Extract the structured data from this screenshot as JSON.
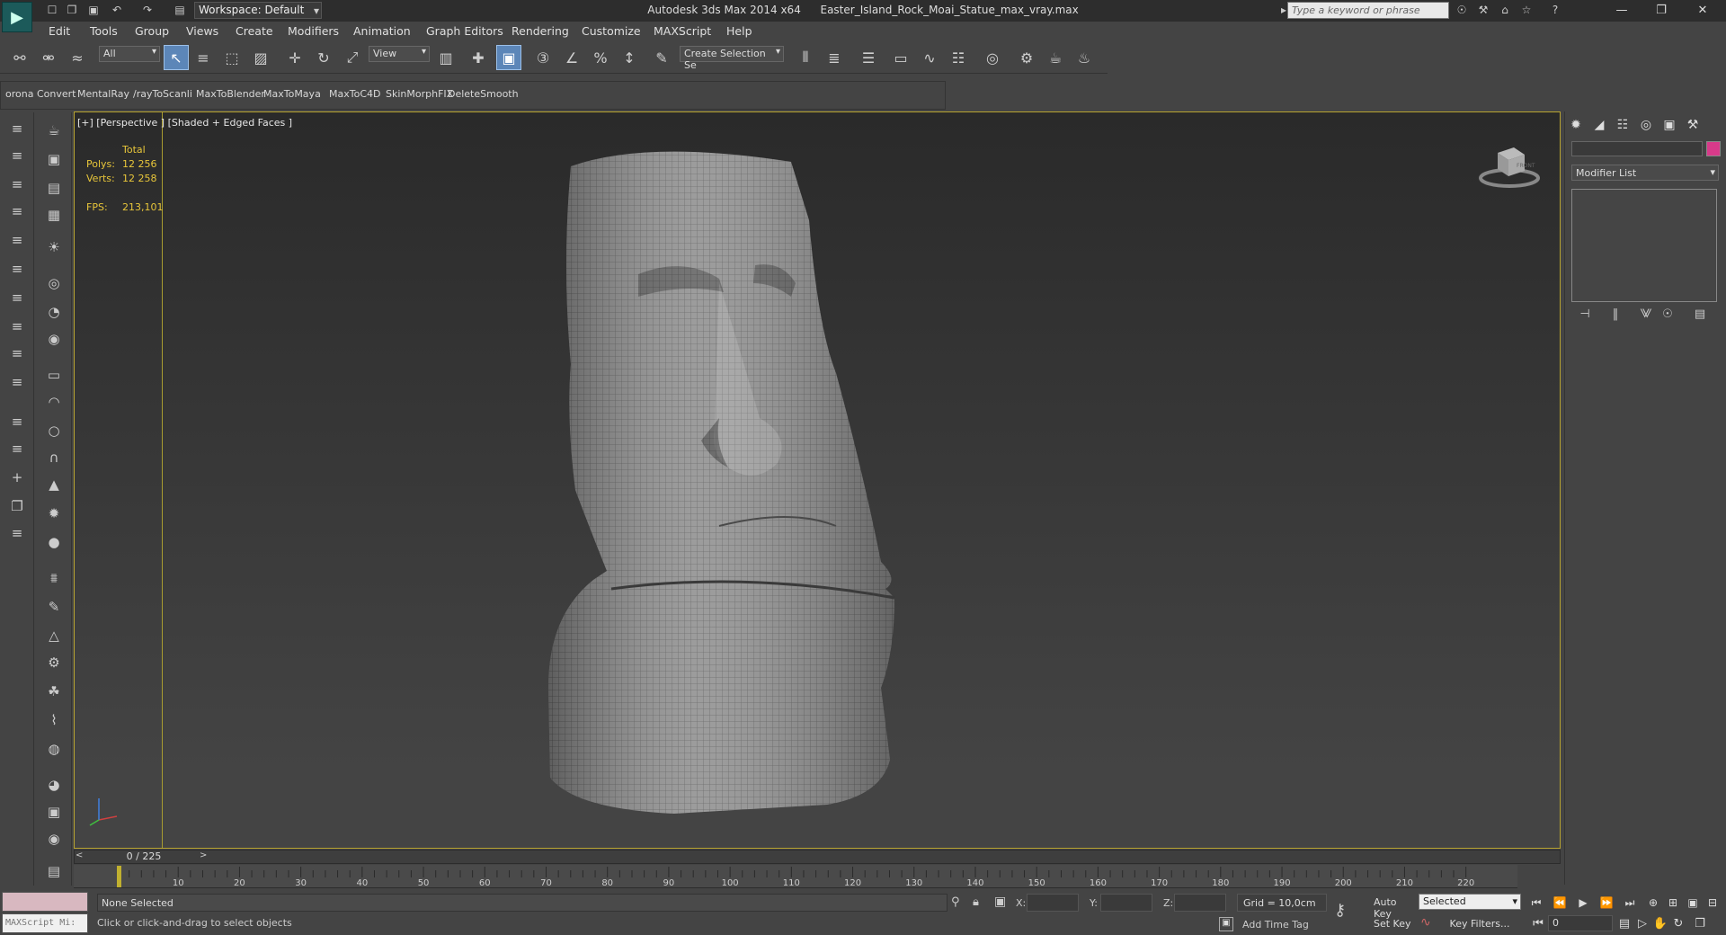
{
  "titlebar": {
    "workspace": "Workspace: Default",
    "app_title": "Autodesk 3ds Max  2014 x64",
    "file_name": "Easter_Island_Rock_Moai_Statue_max_vray.max",
    "search_placeholder": "Type a keyword or phrase"
  },
  "menu": [
    "Edit",
    "Tools",
    "Group",
    "Views",
    "Create",
    "Modifiers",
    "Animation",
    "Graph Editors",
    "Rendering",
    "Customize",
    "MAXScript",
    "Help"
  ],
  "toolbar": {
    "filter": "All",
    "ref_coord": "View",
    "named_selection": "Create Selection Se"
  },
  "plugins": [
    "orona Convert",
    "MentalRay",
    "/rayToScanline",
    "MaxToBlender",
    "MaxToMaya",
    "MaxToC4D",
    "SkinMorphFIX",
    "DeleteSmooth"
  ],
  "viewport": {
    "label": "[+] [Perspective ] [Shaded + Edged Faces ]",
    "stats": {
      "header": "Total",
      "polys_label": "Polys:",
      "polys": "12 256",
      "verts_label": "Verts:",
      "verts": "12 258",
      "fps_label": "FPS:",
      "fps": "213,101"
    },
    "viewcube_label": "FRONT"
  },
  "command_panel": {
    "modifier_list": "Modifier List"
  },
  "timeline": {
    "frame_label": "0 / 225",
    "ticks": [
      "10",
      "20",
      "30",
      "40",
      "50",
      "60",
      "70",
      "80",
      "90",
      "100",
      "110",
      "120",
      "130",
      "140",
      "150",
      "160",
      "170",
      "180",
      "190",
      "200",
      "210",
      "220"
    ]
  },
  "status": {
    "maxscript": "MAXScript Mi:",
    "selection": "None Selected",
    "prompt": "Click or click-and-drag to select objects",
    "x_label": "X:",
    "y_label": "Y:",
    "z_label": "Z:",
    "grid": "Grid = 10,0cm",
    "add_time_tag": "Add Time Tag",
    "auto_key": "Auto Key",
    "set_key": "Set Key",
    "selected": "Selected",
    "key_filters": "Key Filters...",
    "frame": "0"
  },
  "colors": {
    "viewport_border": "#b8a430",
    "stats_text": "#e8c63a",
    "active_tool": "#5c86b8",
    "color_swatch": "#d83a8a"
  }
}
